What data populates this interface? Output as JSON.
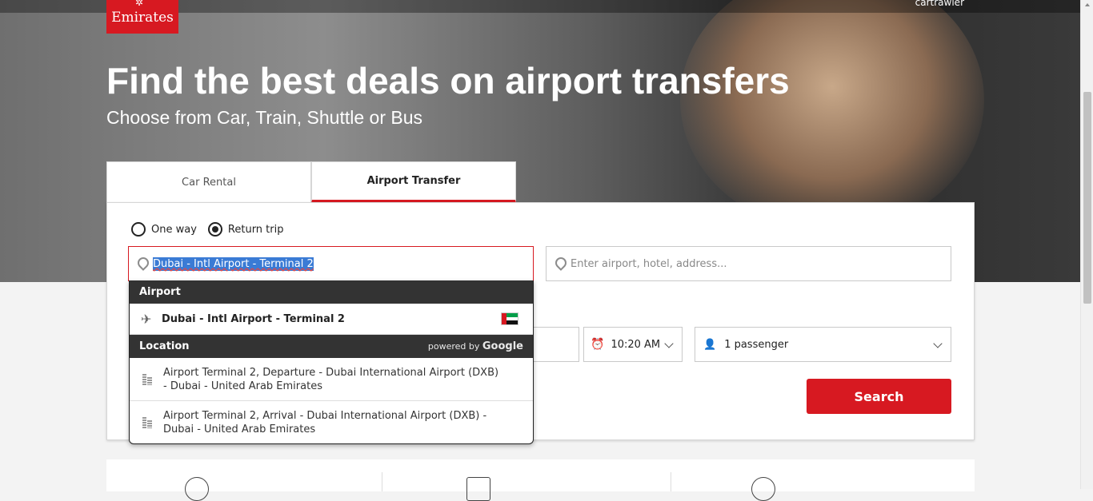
{
  "brand": {
    "name": "Emirates",
    "partner": "cartrawler",
    "accent": "#d71921"
  },
  "hero": {
    "title": "Find the best deals on airport transfers",
    "subtitle": "Choose from Car, Train, Shuttle or Bus"
  },
  "tabs": [
    {
      "label": "Car Rental",
      "active": false
    },
    {
      "label": "Airport Transfer",
      "active": true
    }
  ],
  "trip_type": {
    "options": [
      {
        "label": "One way",
        "selected": false
      },
      {
        "label": "Return trip",
        "selected": true
      }
    ]
  },
  "form": {
    "from_value": "Dubai - Intl Airport - Terminal 2",
    "to_placeholder": "Enter airport, hotel, address...",
    "time_value": "10:20 AM",
    "passengers_value": "1 passenger",
    "search_label": "Search"
  },
  "dropdown": {
    "airport_header": "Airport",
    "airport_item": "Dubai - Intl Airport - Terminal 2",
    "location_header": "Location",
    "powered_by": "powered by",
    "powered_by_brand": "Google",
    "locations": [
      {
        "line1": "Airport Terminal 2, Departure - Dubai International Airport (DXB)",
        "line2": "- Dubai - United Arab Emirates"
      },
      {
        "line1": "Airport Terminal 2, Arrival - Dubai International Airport (DXB) -",
        "line2": "Dubai - United Arab Emirates"
      }
    ]
  },
  "icons": [
    "map-pin-icon",
    "plane-icon",
    "uae-flag-icon",
    "building-icon",
    "clock-icon",
    "user-icon",
    "chevron-down-icon"
  ]
}
